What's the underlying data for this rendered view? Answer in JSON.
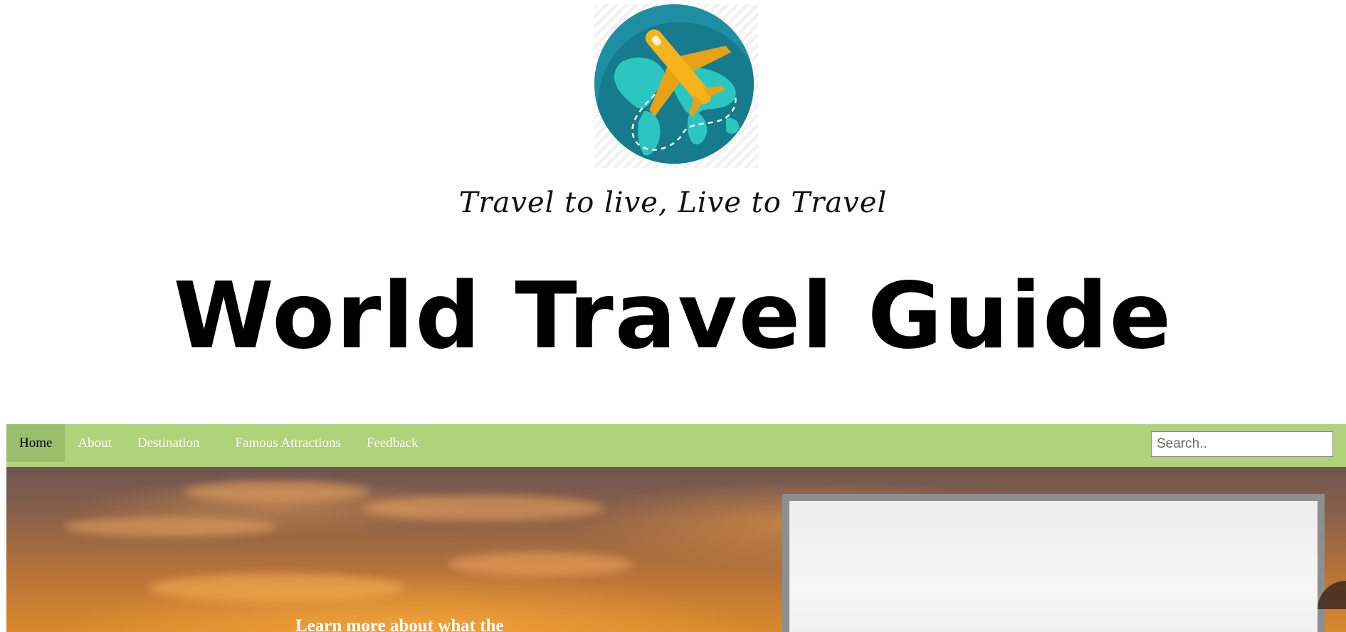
{
  "header": {
    "logo_icon": "globe-airplane-logo",
    "tagline": "Travel to live, Live to Travel",
    "title": "World Travel Guide"
  },
  "nav": {
    "items": [
      {
        "label": "Home",
        "active": true
      },
      {
        "label": "About",
        "active": false
      },
      {
        "label": "Destination",
        "active": false
      },
      {
        "label": "Famous Attractions",
        "active": false
      },
      {
        "label": "Feedback",
        "active": false
      }
    ],
    "search_placeholder": "Search.."
  },
  "hero": {
    "text": "Learn more about what the"
  },
  "colors": {
    "nav_bg": "#afd27b",
    "nav_active_bg": "#99bf6c",
    "logo_circle": "#1e8fa3",
    "logo_land": "#2cc6c0",
    "plane": "#f5b31c"
  }
}
